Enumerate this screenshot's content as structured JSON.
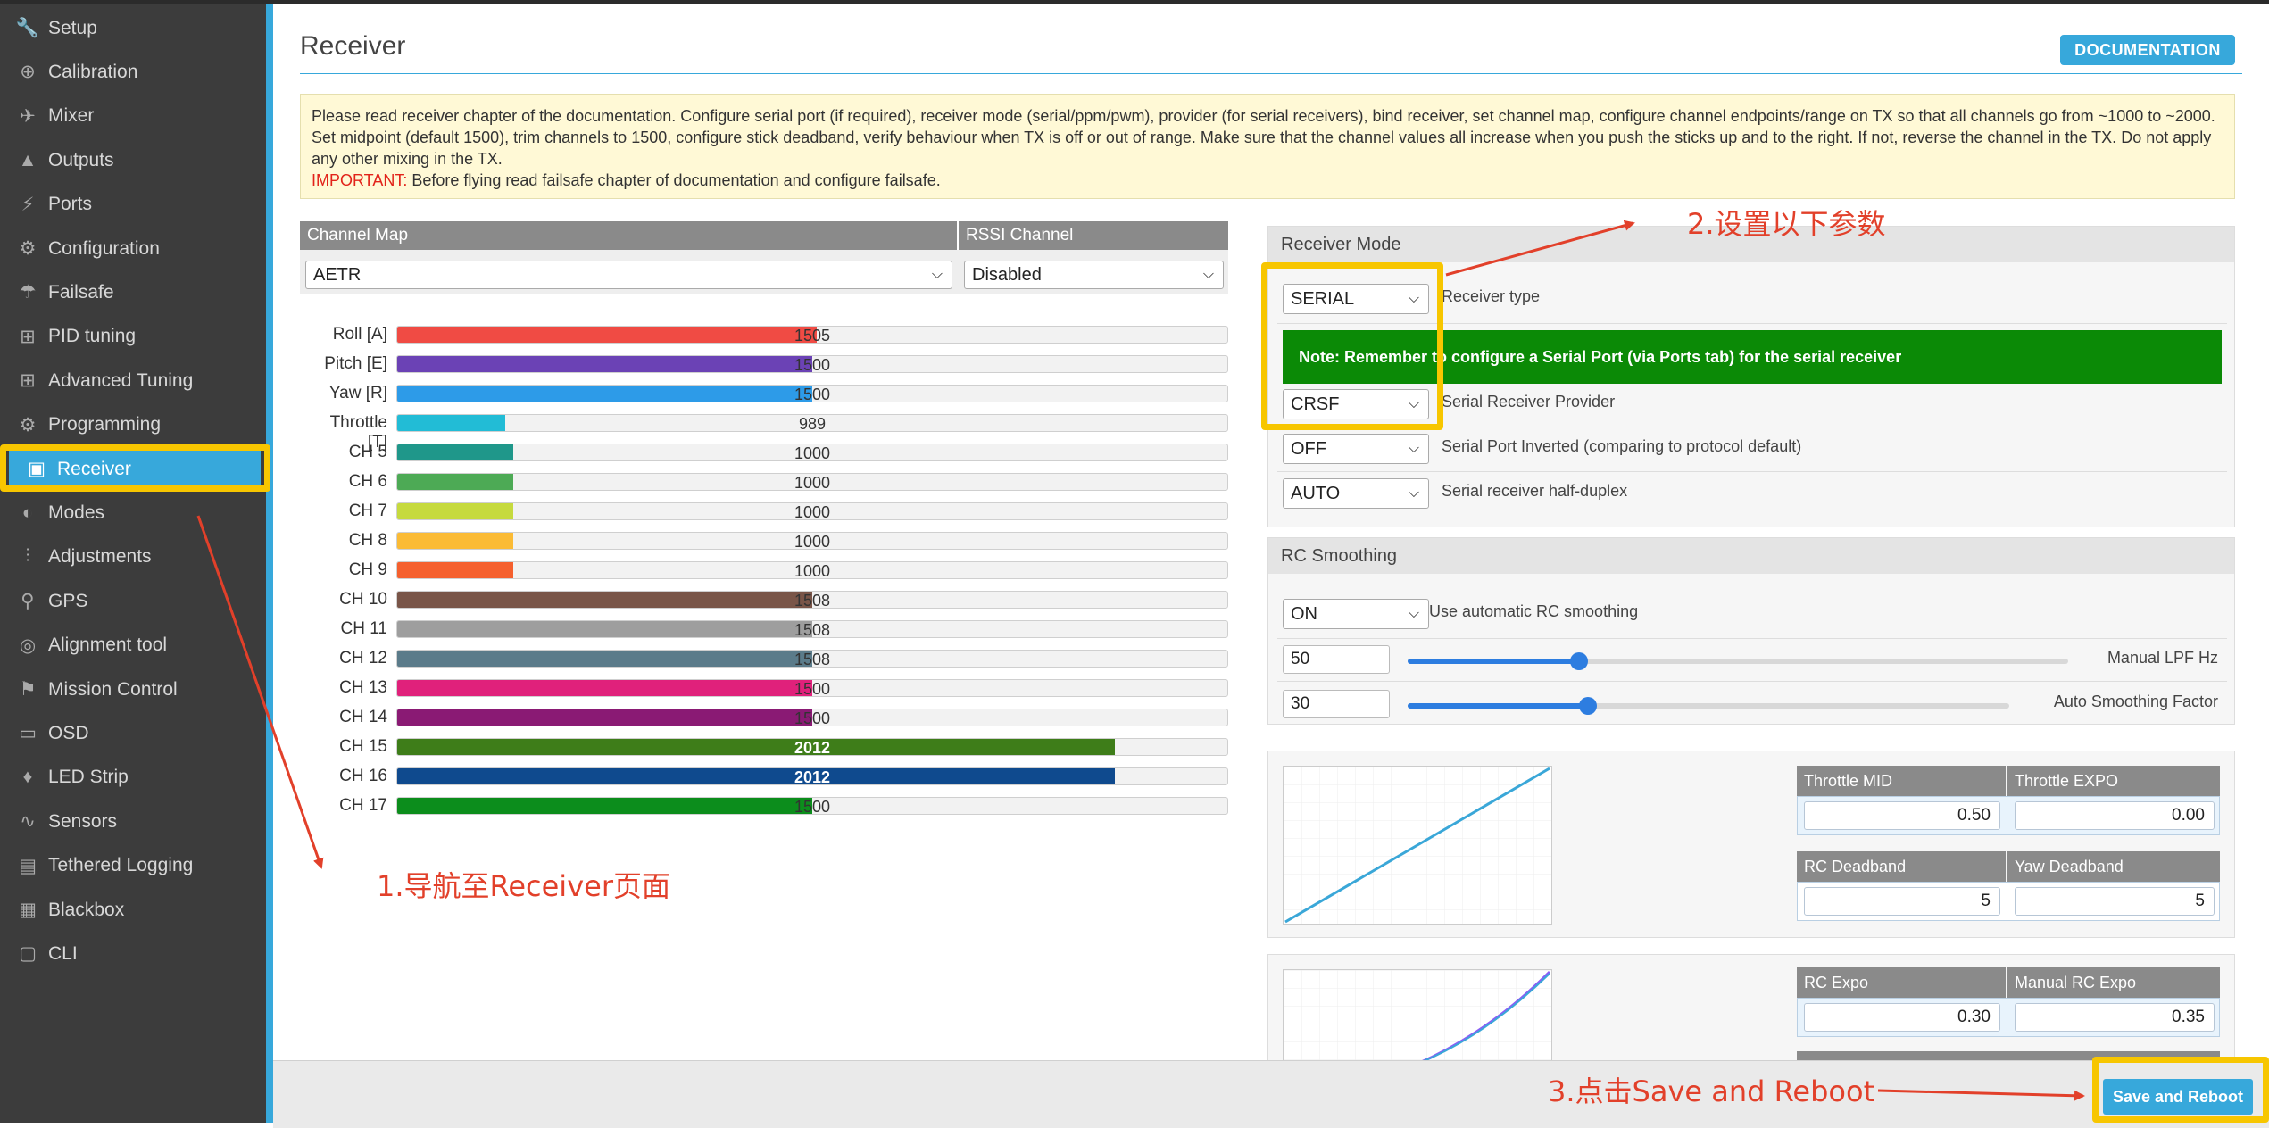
{
  "sidebar": {
    "items": [
      {
        "label": "Setup",
        "icon": "wrench-icon",
        "glyph": "🔧"
      },
      {
        "label": "Calibration",
        "icon": "crosshair-icon",
        "glyph": "⊕"
      },
      {
        "label": "Mixer",
        "icon": "mixer-icon",
        "glyph": "✈"
      },
      {
        "label": "Outputs",
        "icon": "motor-icon",
        "glyph": "▲"
      },
      {
        "label": "Ports",
        "icon": "plug-icon",
        "glyph": "⚡"
      },
      {
        "label": "Configuration",
        "icon": "gear-icon",
        "glyph": "⚙"
      },
      {
        "label": "Failsafe",
        "icon": "parachute-icon",
        "glyph": "☂"
      },
      {
        "label": "PID tuning",
        "icon": "sliders-icon",
        "glyph": "⊞"
      },
      {
        "label": "Advanced Tuning",
        "icon": "sliders-icon",
        "glyph": "⊞"
      },
      {
        "label": "Programming",
        "icon": "gear-icon",
        "glyph": "⚙"
      },
      {
        "label": "Receiver",
        "icon": "receiver-icon",
        "glyph": "▣",
        "active": true
      },
      {
        "label": "Modes",
        "icon": "toggle-icon",
        "glyph": "◐"
      },
      {
        "label": "Adjustments",
        "icon": "adjust-icon",
        "glyph": "⫶"
      },
      {
        "label": "GPS",
        "icon": "satellite-icon",
        "glyph": "⚲"
      },
      {
        "label": "Alignment tool",
        "icon": "compass-icon",
        "glyph": "◎"
      },
      {
        "label": "Mission Control",
        "icon": "map-pin-icon",
        "glyph": "⚑"
      },
      {
        "label": "OSD",
        "icon": "osd-icon",
        "glyph": "▭"
      },
      {
        "label": "LED Strip",
        "icon": "led-icon",
        "glyph": "♦"
      },
      {
        "label": "Sensors",
        "icon": "pulse-icon",
        "glyph": "∿"
      },
      {
        "label": "Tethered Logging",
        "icon": "log-icon",
        "glyph": "▤"
      },
      {
        "label": "Blackbox",
        "icon": "blackbox-icon",
        "glyph": "▦"
      },
      {
        "label": "CLI",
        "icon": "terminal-icon",
        "glyph": "▢"
      }
    ]
  },
  "header": {
    "title": "Receiver",
    "doc_button": "DOCUMENTATION"
  },
  "notice": {
    "text": "Please read receiver chapter of the documentation. Configure serial port (if required), receiver mode (serial/ppm/pwm), provider (for serial receivers), bind receiver, set channel map, configure channel endpoints/range on TX so that all channels go from ~1000 to ~2000. Set midpoint (default 1500), trim channels to 1500, configure stick deadband, verify behaviour when TX is off or out of range. Make sure that the channel values all increase when you push the sticks up and to the right. If not, reverse the channel in the TX. Do not apply any other mixing in the TX.",
    "important_label": "IMPORTANT:",
    "important_text": " Before flying read failsafe chapter of documentation and configure failsafe."
  },
  "channel_map": {
    "header": "Channel Map",
    "value": "AETR",
    "rssi_header": "RSSI Channel",
    "rssi_value": "Disabled"
  },
  "channels": [
    {
      "label": "Roll [A]",
      "value": "1505",
      "level": 0.505,
      "color": "#f04b44"
    },
    {
      "label": "Pitch [E]",
      "value": "1500",
      "level": 0.5,
      "color": "#6b42b5"
    },
    {
      "label": "Yaw [R]",
      "value": "1500",
      "level": 0.5,
      "color": "#2d9be8"
    },
    {
      "label": "Throttle [T]",
      "value": "989",
      "level": 0.13,
      "color": "#22bcd6"
    },
    {
      "label": "CH 5",
      "value": "1000",
      "level": 0.14,
      "color": "#1f978a"
    },
    {
      "label": "CH 6",
      "value": "1000",
      "level": 0.14,
      "color": "#4daa55"
    },
    {
      "label": "CH 7",
      "value": "1000",
      "level": 0.14,
      "color": "#c6da3e"
    },
    {
      "label": "CH 8",
      "value": "1000",
      "level": 0.14,
      "color": "#fbbb35"
    },
    {
      "label": "CH 9",
      "value": "1000",
      "level": 0.14,
      "color": "#f5602e"
    },
    {
      "label": "CH 10",
      "value": "1508",
      "level": 0.5,
      "color": "#795548"
    },
    {
      "label": "CH 11",
      "value": "1508",
      "level": 0.5,
      "color": "#9e9e9e"
    },
    {
      "label": "CH 12",
      "value": "1508",
      "level": 0.5,
      "color": "#5b7b8a"
    },
    {
      "label": "CH 13",
      "value": "1500",
      "level": 0.5,
      "color": "#e0217b"
    },
    {
      "label": "CH 14",
      "value": "1500",
      "level": 0.5,
      "color": "#8a1a74"
    },
    {
      "label": "CH 15",
      "value": "2012",
      "level": 0.865,
      "color": "#3e7d19",
      "light": true
    },
    {
      "label": "CH 16",
      "value": "2012",
      "level": 0.865,
      "color": "#0f4a8e",
      "light": true
    },
    {
      "label": "CH 17",
      "value": "1500",
      "level": 0.5,
      "color": "#0c8d1c"
    }
  ],
  "receiver_mode": {
    "header": "Receiver Mode",
    "type_value": "SERIAL",
    "type_label": "Receiver type",
    "note": "Note: Remember to configure a Serial Port (via Ports tab) for the serial receiver",
    "provider_value": "CRSF",
    "provider_label": "Serial Receiver Provider",
    "inverted_value": "OFF",
    "inverted_label": "Serial Port Inverted (comparing to protocol default)",
    "halfduplex_value": "AUTO",
    "halfduplex_label": "Serial receiver half-duplex"
  },
  "rc_smoothing": {
    "header": "RC Smoothing",
    "auto_value": "ON",
    "auto_label": "Use automatic RC smoothing",
    "lpf_value": "50",
    "lpf_label": "Manual LPF Hz",
    "lpf_level": 0.26,
    "factor_value": "30",
    "factor_label": "Auto Smoothing Factor",
    "factor_level": 0.3
  },
  "throttle": {
    "mid_label": "Throttle MID",
    "mid_value": "0.50",
    "expo_label": "Throttle EXPO",
    "expo_value": "0.00",
    "rc_deadband_label": "RC Deadband",
    "rc_deadband_value": "5",
    "yaw_deadband_label": "Yaw Deadband",
    "yaw_deadband_value": "5"
  },
  "expo": {
    "rc_expo_label": "RC Expo",
    "rc_expo_value": "0.30",
    "manual_expo_label": "Manual RC Expo",
    "manual_expo_value": "0.35"
  },
  "footer": {
    "save_label": "Save and Reboot"
  },
  "annotations": {
    "step1": "1.导航至Receiver页面",
    "step2": "2.设置以下参数",
    "step3": "3.点击Save and Reboot"
  },
  "colors": {
    "accent": "#37a8db",
    "annotation": "#e2402a",
    "highlight": "#f7c600",
    "note_green": "#0b8a06"
  }
}
